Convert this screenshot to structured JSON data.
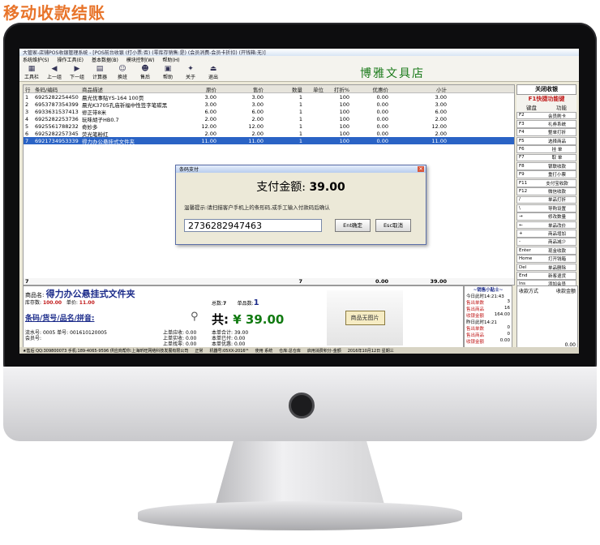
{
  "banner": "移动收款结账",
  "window": {
    "title": "大管家-店铺POS收银管理系统 - [POS前台收银 (打小票:否) (零库存销售:是) (会员消费-会员卡折扣) (开钱箱:无)]",
    "menu": [
      "系统维护(S)",
      "操作工具(E)",
      "基本数据(B)",
      "模块控制(W)",
      "帮助(H)"
    ]
  },
  "toolbar": {
    "buttons": [
      {
        "label": "工具栏",
        "icon": "toolbox-icon"
      },
      {
        "label": "上一组",
        "icon": "arrow-left-icon"
      },
      {
        "label": "下一组",
        "icon": "arrow-right-icon"
      },
      {
        "label": "计算器",
        "icon": "calculator-icon"
      },
      {
        "label": "换班",
        "icon": "shift-change-icon"
      },
      {
        "label": "售后",
        "icon": "after-sales-icon"
      },
      {
        "label": "帮助",
        "icon": "help-icon"
      },
      {
        "label": "关于",
        "icon": "about-icon"
      },
      {
        "label": "退出",
        "icon": "exit-icon"
      }
    ],
    "store_name": "博雅文具店"
  },
  "table": {
    "headers": [
      "行",
      "条码/编码",
      "商品描述",
      "原价",
      "售价",
      "数量",
      "单位",
      "打折%",
      "优惠价",
      "小计"
    ],
    "rows": [
      [
        "1",
        "6925282254450",
        "晨光优事贴YS-164 100页",
        "3.00",
        "3.00",
        "1",
        "",
        "100",
        "0.00",
        "3.00"
      ],
      [
        "2",
        "6953787354399",
        "晨光K3705孔庙祈福中性签字笔碳黑",
        "3.00",
        "3.00",
        "1",
        "",
        "100",
        "0.00",
        "3.00"
      ],
      [
        "3",
        "6933631537413",
        "修正带8米",
        "6.00",
        "6.00",
        "1",
        "",
        "100",
        "0.00",
        "6.00"
      ],
      [
        "4",
        "6925282253736",
        "玩味胡子HB0.7",
        "2.00",
        "2.00",
        "1",
        "",
        "100",
        "0.00",
        "2.00"
      ],
      [
        "5",
        "6925561788232",
        "奇妙多",
        "12.00",
        "12.00",
        "1",
        "",
        "100",
        "0.00",
        "12.00"
      ],
      [
        "6",
        "6925282257345",
        "荧光笔粉红",
        "2.00",
        "2.00",
        "1",
        "",
        "100",
        "0.00",
        "2.00"
      ],
      [
        "7",
        "6921734953339",
        "得力办公悬挂式文件夹",
        "11.00",
        "11.00",
        "1",
        "",
        "100",
        "0.00",
        "11.00"
      ]
    ],
    "totals": {
      "rows": "7",
      "qty": "7",
      "discount": "0.00",
      "subtotal": "39.00"
    }
  },
  "right_panel": {
    "close_label": "关闭收银",
    "shortcut_title": "F1快捷功能键",
    "col_key": "键盘",
    "col_func": "功能",
    "keys": [
      [
        "F2",
        "会员刷卡"
      ],
      [
        "F3",
        "礼券系统"
      ],
      [
        "F4",
        "整单打折"
      ],
      [
        "F5",
        "选择商品"
      ],
      [
        "F6",
        "挂  单"
      ],
      [
        "F7",
        "取  单"
      ],
      [
        "F8",
        "银联收款"
      ],
      [
        "F9",
        "重打小票"
      ],
      [
        "F11",
        "支付宝收款"
      ],
      [
        "F12",
        "微信收款"
      ],
      [
        "/",
        "单品打折"
      ],
      [
        "\\",
        "导购设置"
      ],
      [
        "→",
        "修改数量"
      ],
      [
        "←",
        "单品改价"
      ],
      [
        "+",
        "商品增加"
      ],
      [
        "-",
        "商品减少"
      ],
      [
        "Enter",
        "现金收款"
      ],
      [
        "Home",
        "打开钱箱"
      ],
      [
        "Del",
        "单品删除"
      ],
      [
        "End",
        "新客退货"
      ],
      [
        "Ins",
        "添加会员"
      ],
      [
        "Esc",
        "重新开单"
      ],
      [
        "↑",
        "上一行"
      ]
    ]
  },
  "bottom": {
    "product_label": "商品名:",
    "product_name": "得力办公悬挂式文件夹",
    "stock_label": "库存数:",
    "stock_value": "100.00",
    "price_label": "单价:",
    "price_value": "11.00",
    "count_label": "总数:",
    "count_value": "7",
    "kinds_label": "单品数:",
    "kinds_value": "1",
    "barcode_label": "条码/货号/品名/拼音:",
    "total_prefix": "共:",
    "total_value": "¥ 39.00",
    "serial_label": "流水号:",
    "serial_value": "0005",
    "order_label": "单号:",
    "order_value": "001610120005",
    "member_label": "会员号:",
    "last_due_label": "上单应收:",
    "last_due": "0.00",
    "last_paid_label": "上单实收:",
    "last_paid": "0.00",
    "last_change_label": "上单找零:",
    "last_change": "0.00",
    "cur_total_label": "本单合计:",
    "cur_total": "39.00",
    "cur_paid_label": "本单已付:",
    "cur_paid": "0.00",
    "cur_disc_label": "本单优惠:",
    "cur_disc": "0.00",
    "no_picture": "商品无图片"
  },
  "tips": {
    "title": "~销售小贴士~",
    "today_label": "今日此时14:21:43",
    "rows_today": [
      [
        "售出单数",
        "3"
      ],
      [
        "售出商品",
        "16"
      ],
      [
        "收银金额",
        "164.00"
      ]
    ],
    "yesterday_label": "昨日此时14:21",
    "rows_yesterday": [
      [
        "售出单数",
        "0"
      ],
      [
        "售出商品",
        "0"
      ],
      [
        "收银金额",
        "0.00"
      ]
    ]
  },
  "payinfo": {
    "method_label": "收款方式",
    "amount_label": "收款金额",
    "amount_value": "0.00"
  },
  "statusbar": {
    "items": [
      "★售后 QQ:309800073 手机:189-4065-9596 供应商帮你:上海昕旺网络科技发展有限公司",
      "正常",
      "机器号:05XX-2016⁰¹",
      "使用 系统",
      "仓库:总仓库",
      "启用消费积分-金额",
      "2016年10月12日 星期三"
    ]
  },
  "dialog": {
    "title": "条码支付",
    "amount_label": "支付金额:",
    "amount_value": "39.00",
    "hint": "温馨提示:请扫描客户手机上的条形码,或手工输入付款码后确认",
    "code": "2736282947463",
    "ok_label": "Ent确定",
    "cancel_label": "Esc取消"
  }
}
